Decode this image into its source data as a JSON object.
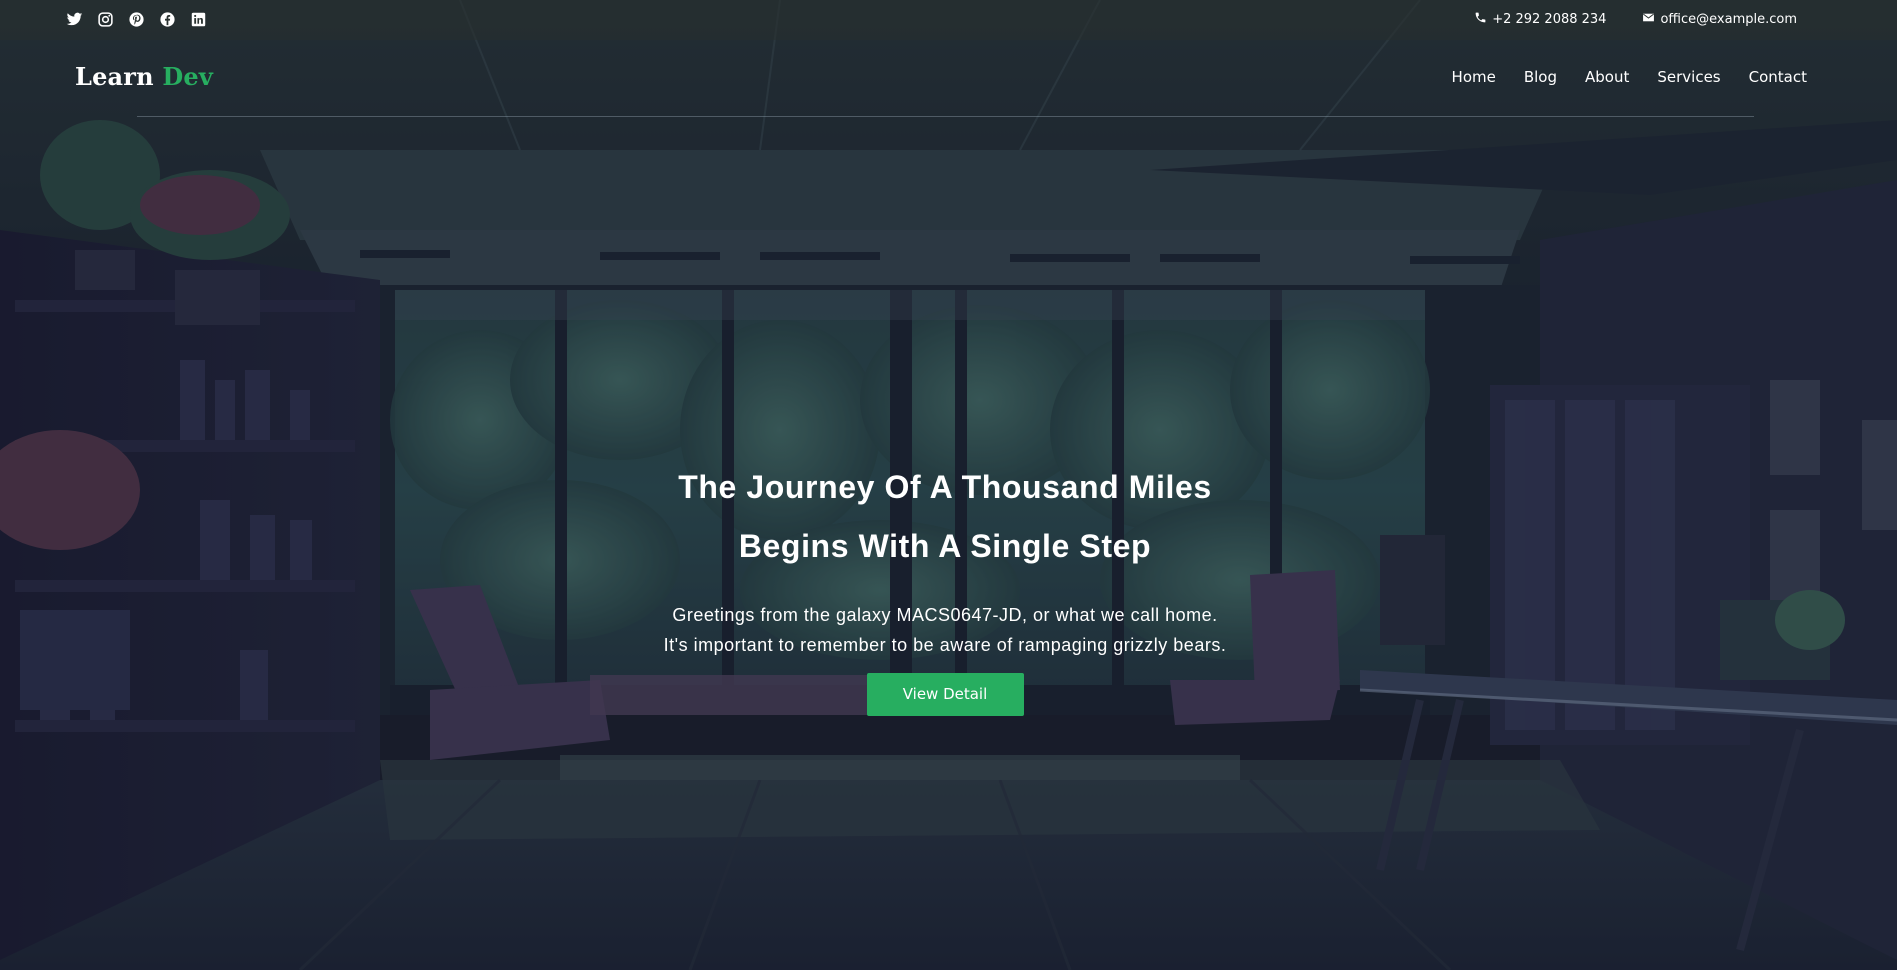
{
  "colors": {
    "accent": "#27ae60",
    "text": "#ffffff",
    "topbar": "#28302e"
  },
  "topbar": {
    "social": [
      {
        "icon": "twitter-icon"
      },
      {
        "icon": "instagram-icon"
      },
      {
        "icon": "pinterest-icon"
      },
      {
        "icon": "facebook-icon"
      },
      {
        "icon": "linkedin-icon"
      }
    ],
    "phone": "+2 292 2088 234",
    "email": "office@example.com"
  },
  "logo": {
    "part1": "Learn",
    "part2": "Dev"
  },
  "nav": {
    "items": [
      "Home",
      "Blog",
      "About",
      "Services",
      "Contact"
    ]
  },
  "hero": {
    "headline_line1": "The Journey Of A Thousand Miles",
    "headline_line2": "Begins With A Single Step",
    "subtext_line1": "Greetings from the galaxy MACS0647-JD, or what we call home.",
    "subtext_line2": "It's important to remember to be aware of rampaging grizzly bears.",
    "cta_label": "View Detail"
  }
}
